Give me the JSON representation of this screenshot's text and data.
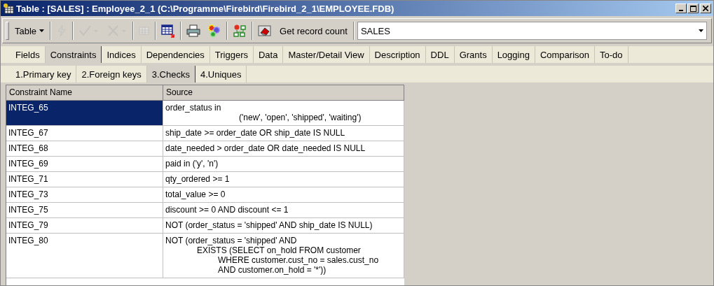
{
  "window": {
    "title": "Table : [SALES] : Employee_2_1 (C:\\Programme\\Firebird\\Firebird_2_1\\EMPLOYEE.FDB)"
  },
  "toolbar": {
    "menu_button": "Table",
    "tools": [
      {
        "kind": "lightning",
        "disabled": true
      },
      {
        "kind": "check",
        "disabled": true
      },
      {
        "kind": "cross",
        "disabled": true
      },
      {
        "kind": "grid",
        "disabled": true
      },
      {
        "kind": "export",
        "disabled": false
      },
      {
        "kind": "printer",
        "disabled": false
      },
      {
        "kind": "gears",
        "disabled": false
      },
      {
        "kind": "tree",
        "disabled": false
      },
      {
        "kind": "eraser",
        "disabled": false
      }
    ],
    "count_button": "Get record count",
    "table_select": "SALES"
  },
  "tabs": [
    {
      "label": "Fields",
      "selected": false
    },
    {
      "label": "Constraints",
      "selected": true
    },
    {
      "label": "Indices",
      "selected": false
    },
    {
      "label": "Dependencies",
      "selected": false
    },
    {
      "label": "Triggers",
      "selected": false
    },
    {
      "label": "Data",
      "selected": false
    },
    {
      "label": "Master/Detail View",
      "selected": false
    },
    {
      "label": "Description",
      "selected": false
    },
    {
      "label": "DDL",
      "selected": false
    },
    {
      "label": "Grants",
      "selected": false
    },
    {
      "label": "Logging",
      "selected": false
    },
    {
      "label": "Comparison",
      "selected": false
    },
    {
      "label": "To-do",
      "selected": false
    }
  ],
  "subtabs": [
    {
      "label": "1.Primary key",
      "selected": false
    },
    {
      "label": "2.Foreign keys",
      "selected": false
    },
    {
      "label": "3.Checks",
      "selected": true
    },
    {
      "label": "4.Uniques",
      "selected": false
    }
  ],
  "table": {
    "columns": [
      "Constraint Name",
      "Source"
    ],
    "rows": [
      {
        "name": "INTEG_65",
        "selected": true,
        "source": [
          {
            "kind": "head",
            "text": "order_status in"
          },
          {
            "kind": "far",
            "text": "('new', 'open', 'shipped', 'waiting')"
          }
        ]
      },
      {
        "name": "INTEG_67",
        "selected": false,
        "source": [
          {
            "kind": "head",
            "text": "ship_date >= order_date OR ship_date IS NULL"
          }
        ]
      },
      {
        "name": "INTEG_68",
        "selected": false,
        "source": [
          {
            "kind": "head",
            "text": "date_needed > order_date OR date_needed IS NULL"
          }
        ]
      },
      {
        "name": "INTEG_69",
        "selected": false,
        "source": [
          {
            "kind": "head",
            "text": "paid in ('y', 'n')"
          }
        ]
      },
      {
        "name": "INTEG_71",
        "selected": false,
        "source": [
          {
            "kind": "head",
            "text": "qty_ordered >= 1"
          }
        ]
      },
      {
        "name": "INTEG_73",
        "selected": false,
        "source": [
          {
            "kind": "head",
            "text": "total_value >= 0"
          }
        ]
      },
      {
        "name": "INTEG_75",
        "selected": false,
        "source": [
          {
            "kind": "head",
            "text": "discount >= 0 AND discount <= 1"
          }
        ]
      },
      {
        "name": "INTEG_79",
        "selected": false,
        "source": [
          {
            "kind": "head",
            "text": "NOT (order_status = 'shipped' AND ship_date IS NULL)"
          }
        ]
      },
      {
        "name": "INTEG_80",
        "selected": false,
        "source": [
          {
            "kind": "head",
            "text": "NOT (order_status = 'shipped' AND"
          },
          {
            "kind": "indent",
            "text": "EXISTS (SELECT on_hold FROM customer"
          },
          {
            "kind": "deep",
            "text": "WHERE customer.cust_no = sales.cust_no"
          },
          {
            "kind": "deep",
            "text": "AND customer.on_hold = '*'))"
          }
        ]
      }
    ]
  }
}
